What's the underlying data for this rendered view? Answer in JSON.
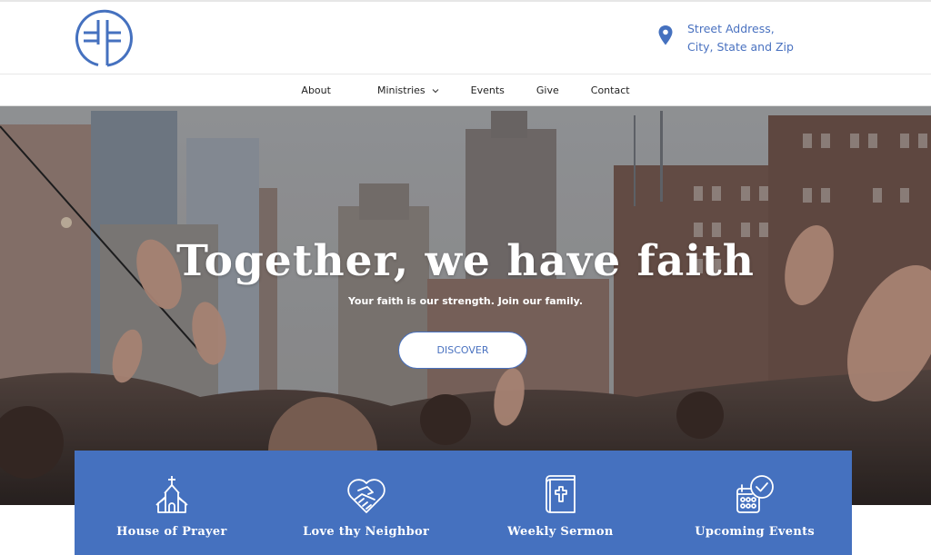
{
  "brand": {
    "logo_icon": "cross-circle-logo-icon",
    "accent_color": "#4571bf"
  },
  "header": {
    "address": {
      "icon": "map-pin-icon",
      "line1": "Street Address,",
      "line2": "City, State and Zip"
    }
  },
  "nav": {
    "items": [
      {
        "label": "About"
      },
      {
        "label": "Ministries",
        "has_dropdown": true,
        "icon": "chevron-down-icon"
      },
      {
        "label": "Events"
      },
      {
        "label": "Give"
      },
      {
        "label": "Contact"
      }
    ]
  },
  "hero": {
    "title": "Together, we have faith",
    "subtitle": "Your faith is our strength. Join our family.",
    "cta_label": "DISCOVER"
  },
  "features": {
    "items": [
      {
        "label": "House of Prayer",
        "icon": "church-icon"
      },
      {
        "label": "Love thy Neighbor",
        "icon": "heart-handshake-icon"
      },
      {
        "label": "Weekly Sermon",
        "icon": "bible-icon"
      },
      {
        "label": "Upcoming Events",
        "icon": "calendar-check-icon"
      }
    ]
  }
}
